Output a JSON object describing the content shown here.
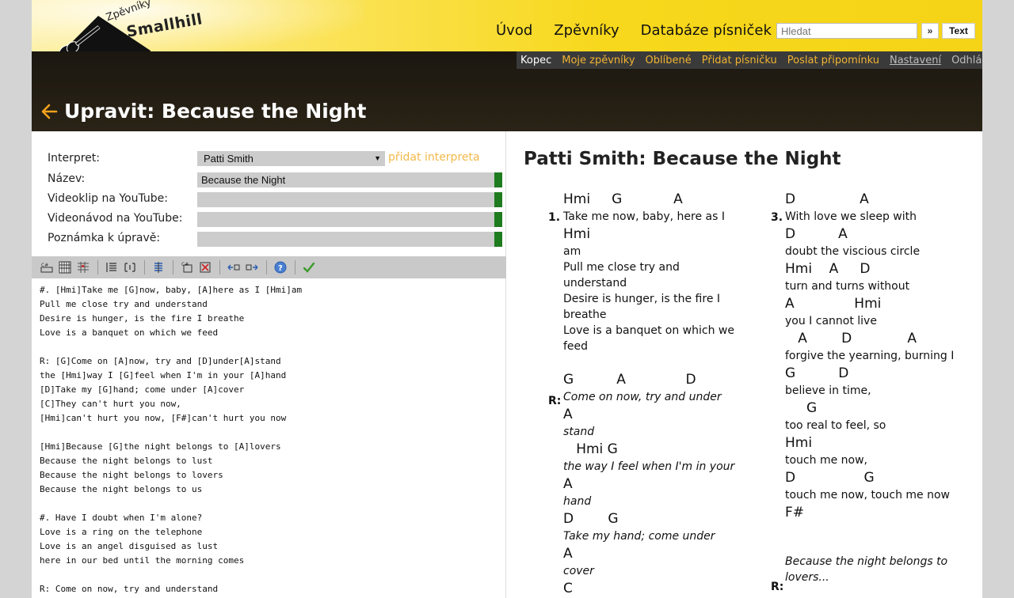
{
  "logo": {
    "word_small": "Zpěvníky",
    "word_big": "Smallhill"
  },
  "main_nav": [
    "Úvod",
    "Zpěvníky",
    "Databáze písniček"
  ],
  "search": {
    "placeholder": "Hledat",
    "go_label": "»",
    "text_label": "Text"
  },
  "user_nav": {
    "user": "Kopec",
    "links": [
      "Moje zpěvníky",
      "Oblíbené",
      "Přidat písničku",
      "Poslat připomínku"
    ],
    "settings": "Nastavení",
    "logout": "Odhlásit"
  },
  "page_title": "Upravit: Because the Night",
  "form": {
    "artist_label": "Interpret:",
    "artist_value": "Patti Smith",
    "add_artist": "přidat interpreta",
    "title_label": "Název:",
    "title_value": "Because the Night",
    "video_label": "Videoklip na YouTube:",
    "tutorial_label": "Videonávod na YouTube:",
    "note_label": "Poznámka k úpravě:"
  },
  "editor_text": "#. [Hmi]Take me [G]now, baby, [A]here as I [Hmi]am\nPull me close try and understand\nDesire is hunger, is the fire I breathe\nLove is a banquet on which we feed\n\nR: [G]Come on [A]now, try and [D]under[A]stand\nthe [Hmi]way I [G]feel when I'm in your [A]hand\n[D]Take my [G]hand; come under [A]cover\n[C]They can't hurt you now,\n[Hmi]can't hurt you now, [F#]can't hurt you now\n\n[Hmi]Because [G]the night belongs to [A]lovers\nBecause the night belongs to lust\nBecause the night belongs to lovers\nBecause the night belongs to us\n\n#. Have I doubt when I'm alone?\nLove is a ring on the telephone\nLove is an angel disguised as lust\nhere in our bed until the morning comes\n\nR: Come on now, try and understand",
  "preview": {
    "heading": "Patti Smith: Because the Night",
    "col1": {
      "verse_num": "1.",
      "chorus_num": "R:",
      "lines": [
        {
          "t": "c",
          "v": "Hmi     G            A"
        },
        {
          "t": "l",
          "v": "Take me now, baby, here as I"
        },
        {
          "t": "c",
          "v": "Hmi"
        },
        {
          "t": "l",
          "v": "am"
        },
        {
          "t": "l",
          "v": "Pull me close try and"
        },
        {
          "t": "l",
          "v": "understand"
        },
        {
          "t": "l",
          "v": "Desire is hunger, is the fire I"
        },
        {
          "t": "l",
          "v": "breathe"
        },
        {
          "t": "l",
          "v": "Love is a banquet on which we"
        },
        {
          "t": "l",
          "v": "feed"
        },
        {
          "t": "g",
          "v": " "
        },
        {
          "t": "c",
          "v": "G          A              D"
        },
        {
          "t": "i",
          "v": "Come on now, try and under"
        },
        {
          "t": "c",
          "v": "A"
        },
        {
          "t": "i",
          "v": "stand"
        },
        {
          "t": "c",
          "v": "   Hmi G"
        },
        {
          "t": "i",
          "v": "the way I  feel when I'm in your"
        },
        {
          "t": "c",
          "v": "A"
        },
        {
          "t": "i",
          "v": "hand"
        },
        {
          "t": "c",
          "v": "D        G"
        },
        {
          "t": "i",
          "v": "Take my hand; come under"
        },
        {
          "t": "c",
          "v": "A"
        },
        {
          "t": "i",
          "v": "cover"
        },
        {
          "t": "c",
          "v": "C"
        }
      ]
    },
    "col2": {
      "verse_num": "3.",
      "chorus_num": "R:",
      "lines": [
        {
          "t": "c",
          "v": "D               A"
        },
        {
          "t": "l",
          "v": "With love we sleep with"
        },
        {
          "t": "c",
          "v": "D          A"
        },
        {
          "t": "l",
          "v": "doubt the viscious circle"
        },
        {
          "t": "c",
          "v": "Hmi    A     D"
        },
        {
          "t": "l",
          "v": "turn and turns without"
        },
        {
          "t": "c",
          "v": "A              Hmi"
        },
        {
          "t": "l",
          "v": "you I cannot live"
        },
        {
          "t": "c",
          "v": "   A        D             A"
        },
        {
          "t": "l",
          "v": "forgive the yearning, burning I"
        },
        {
          "t": "c",
          "v": "G          D"
        },
        {
          "t": "l",
          "v": "believe in time,"
        },
        {
          "t": "c",
          "v": "     G"
        },
        {
          "t": "l",
          "v": "too real to feel, so"
        },
        {
          "t": "c",
          "v": "Hmi"
        },
        {
          "t": "l",
          "v": "touch me now,"
        },
        {
          "t": "c",
          "v": "D                G"
        },
        {
          "t": "l",
          "v": "touch me now,  touch me now"
        },
        {
          "t": "c",
          "v": "F#"
        },
        {
          "t": "g",
          "v": " "
        },
        {
          "t": "g",
          "v": " "
        },
        {
          "t": "i",
          "v": "Because the night belongs to"
        },
        {
          "t": "i",
          "v": "lovers..."
        }
      ]
    }
  }
}
